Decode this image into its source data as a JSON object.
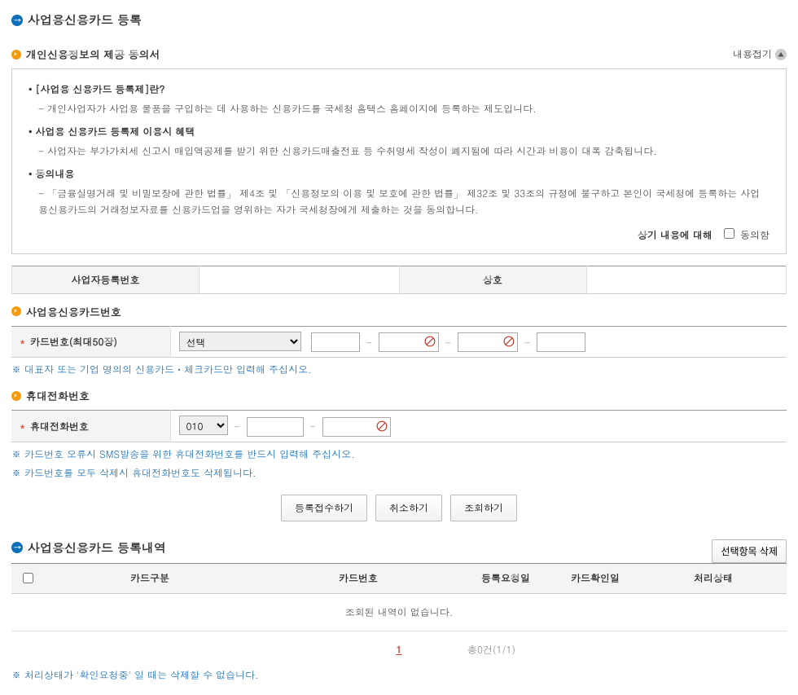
{
  "title": "사업용신용카드 등록",
  "sec1": {
    "title": "개인신용정보의 제공 동의서",
    "collapse_label": "내용접기"
  },
  "consent": {
    "h1": "[사업용 신용카드 등록제]란?",
    "c1": "개인사업자가 사업용 물품을 구입하는 데 사용하는 신용카드를 국세청 홈택스 홈페이지에 등록하는 제도입니다.",
    "h2": "사업용 신용카드 등록제 이용시 혜택",
    "c2": "사업자는 부가가치세 신고시 매입액공제를 받기 위한 신용카드매출전표 등 수취명세 작성이 폐지됨에 따라 시간과 비용이 대폭 감축됩니다.",
    "h3": "동의내용",
    "c3": "「금융실명거래 및 비밀보장에 관한 법률」 제4조 및 「신용정보의 이용 및 보호에 관한 법률」 제32조 및 33조의 규정에 불구하고 본인이 국세청에 등록하는 사업용신용카드의    거래정보자료를 신용카드업을 영위하는 자가 국세청장에게 제출하는 것을 동의합니다.",
    "agree_prefix": "상기 내용에 대해",
    "agree_label": "동의함"
  },
  "biz": {
    "reg_label": "사업자등록번호",
    "name_label": "상호"
  },
  "sec_card": {
    "title": "사업용신용카드번호",
    "field_label": "카드번호(최대50장)",
    "select_default": "선택"
  },
  "card_note": "대표자 또는 기업 명의의 신용카드ㆍ체크카드만 입력해 주십시오.",
  "sec_phone": {
    "title": "휴대전화번호",
    "field_label": "휴대전화번호",
    "prefix": "010"
  },
  "phone_note1": "카드번호 오류시 SMS발송을 위한 휴대전화번호를 반드시 입력해 주십시오.",
  "phone_note2": "카드번호를 모두 삭제시 휴대전화번호도 삭제됩니다.",
  "buttons": {
    "submit": "등록접수하기",
    "cancel": "취소하기",
    "query": "조회하기",
    "delete_sel": "선택항목 삭제"
  },
  "sec_list": {
    "title": "사업용신용카드 등록내역"
  },
  "list": {
    "cols": {
      "type": "카드구분",
      "number": "카드번호",
      "req_date": "등록요청일",
      "conf_date": "카드확인일",
      "status": "처리상태"
    },
    "empty": "조회된 내역이 없습니다.",
    "page": "1",
    "count": "총0건(1/1)"
  },
  "footer_note": "처리상태가 '확인요청중' 일 때는 삭제할 수 없습니다."
}
